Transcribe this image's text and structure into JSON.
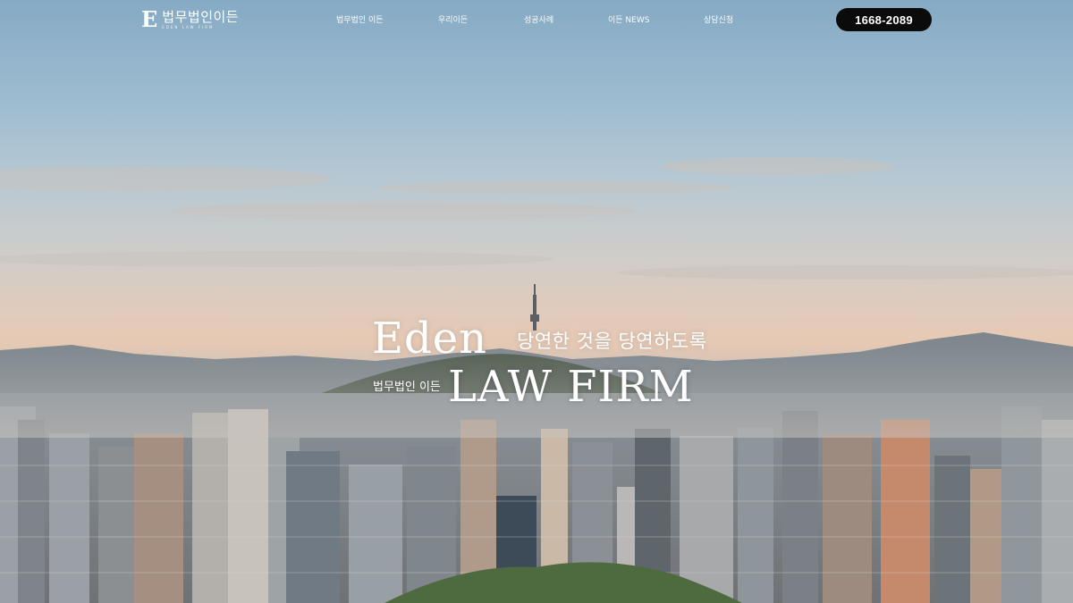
{
  "header": {
    "logo_mark": "E",
    "logo_text": "법무법인이든",
    "logo_sub": "EDEN LAW FIRM",
    "menu": [
      "법무법인 이든",
      "우리이든",
      "성공사례",
      "이든 NEWS",
      "상담신청"
    ],
    "phone": "1668-2089"
  },
  "hero": {
    "brand_eden": "Eden",
    "slogan": "당연한 것을 당연하도록",
    "firm_korean": "법무법인 이든",
    "brand_lawfirm": "LAW FIRM"
  },
  "colors": {
    "sky_top": "#86aac4",
    "horizon": "#e7c9b3",
    "phone_button": "#0b0b0b",
    "text": "#ffffff"
  }
}
